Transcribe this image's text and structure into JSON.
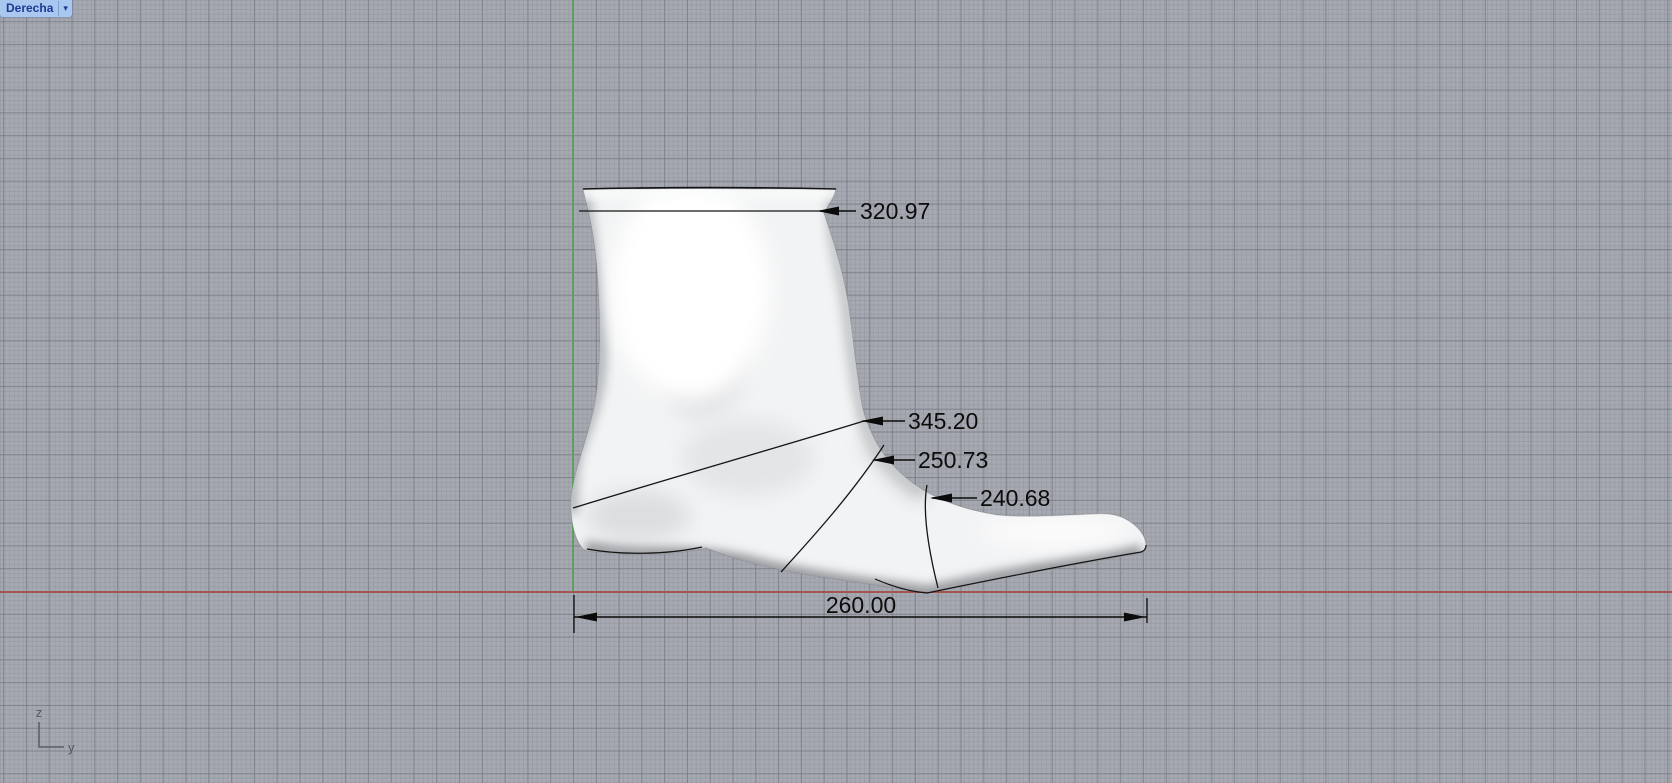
{
  "viewport_label": {
    "text": "Derecha",
    "dropdown_glyph": "▾",
    "dropdown_icon": "chevron-down-icon"
  },
  "annotations": {
    "leg_girth": "320.97",
    "instep_girth": "345.20",
    "waist_girth": "250.73",
    "ball_girth": "240.68",
    "foot_length": "260.00"
  },
  "axis_gnomon": {
    "z_label": "z",
    "y_label": "y"
  },
  "colors": {
    "grid_background": "#a6a9b1",
    "grid_major_line": "#70747c",
    "grid_minor_line": "#8c9098",
    "z_axis_green": "#5da05d",
    "y_axis_red": "#a2564f",
    "model_surface": "#f2f3f4",
    "annotation_line": "#0b0b0b",
    "viewport_label_bg": "#a9c7ef",
    "viewport_label_text": "#1c3a92"
  }
}
